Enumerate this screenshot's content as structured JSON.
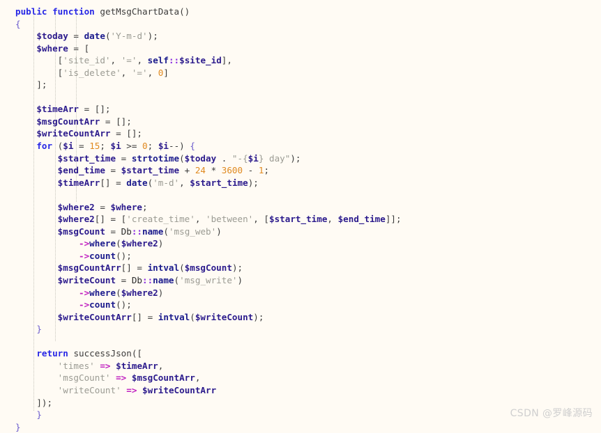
{
  "editor": {
    "language": "PHP",
    "background_color": "#fffbf4",
    "colors": {
      "keyword": "#2727e6",
      "function": "#1a1a8c",
      "variable": "#2b1a8c",
      "string": "#9b9b93",
      "number": "#e08a20",
      "arrow_operator": "#c020c0",
      "double_colon": "#8a2be2",
      "brace": "#6a5acd",
      "plain_text": "#3c3c3c",
      "indent_guide": "#c8c6bd"
    },
    "indent_guide_columns": [
      1,
      2,
      3
    ],
    "code_lines": [
      [
        {
          "t": "public",
          "c": "tok-kw"
        },
        {
          "t": " ",
          "c": "tok-op"
        },
        {
          "t": "function",
          "c": "tok-kw"
        },
        {
          "t": " ",
          "c": "tok-op"
        },
        {
          "t": "getMsgChartData",
          "c": "tok-fname"
        },
        {
          "t": "()",
          "c": "tok-brk"
        }
      ],
      [
        {
          "t": "{",
          "c": "tok-brace"
        }
      ],
      [
        {
          "t": "    ",
          "c": "tok-op"
        },
        {
          "t": "$today",
          "c": "tok-var"
        },
        {
          "t": " = ",
          "c": "tok-op"
        },
        {
          "t": "date",
          "c": "tok-fn"
        },
        {
          "t": "(",
          "c": "tok-brk"
        },
        {
          "t": "'Y-m-d'",
          "c": "tok-str"
        },
        {
          "t": ");",
          "c": "tok-brk"
        }
      ],
      [
        {
          "t": "    ",
          "c": "tok-op"
        },
        {
          "t": "$where",
          "c": "tok-var"
        },
        {
          "t": " = ",
          "c": "tok-op"
        },
        {
          "t": "[",
          "c": "tok-brk"
        }
      ],
      [
        {
          "t": "        ",
          "c": "tok-op"
        },
        {
          "t": "[",
          "c": "tok-brk"
        },
        {
          "t": "'site_id'",
          "c": "tok-str"
        },
        {
          "t": ", ",
          "c": "tok-op"
        },
        {
          "t": "'='",
          "c": "tok-str"
        },
        {
          "t": ", ",
          "c": "tok-op"
        },
        {
          "t": "self",
          "c": "tok-fn"
        },
        {
          "t": "::",
          "c": "tok-dcolon"
        },
        {
          "t": "$site_id",
          "c": "tok-var"
        },
        {
          "t": "],",
          "c": "tok-brk"
        }
      ],
      [
        {
          "t": "        ",
          "c": "tok-op"
        },
        {
          "t": "[",
          "c": "tok-brk"
        },
        {
          "t": "'is_delete'",
          "c": "tok-str"
        },
        {
          "t": ", ",
          "c": "tok-op"
        },
        {
          "t": "'='",
          "c": "tok-str"
        },
        {
          "t": ", ",
          "c": "tok-op"
        },
        {
          "t": "0",
          "c": "tok-num"
        },
        {
          "t": "]",
          "c": "tok-brk"
        }
      ],
      [
        {
          "t": "    ",
          "c": "tok-op"
        },
        {
          "t": "];",
          "c": "tok-brk"
        }
      ],
      [],
      [
        {
          "t": "    ",
          "c": "tok-op"
        },
        {
          "t": "$timeArr",
          "c": "tok-var"
        },
        {
          "t": " = ",
          "c": "tok-op"
        },
        {
          "t": "[];",
          "c": "tok-brk"
        }
      ],
      [
        {
          "t": "    ",
          "c": "tok-op"
        },
        {
          "t": "$msgCountArr",
          "c": "tok-var"
        },
        {
          "t": " = ",
          "c": "tok-op"
        },
        {
          "t": "[];",
          "c": "tok-brk"
        }
      ],
      [
        {
          "t": "    ",
          "c": "tok-op"
        },
        {
          "t": "$writeCountArr",
          "c": "tok-var"
        },
        {
          "t": " = ",
          "c": "tok-op"
        },
        {
          "t": "[];",
          "c": "tok-brk"
        }
      ],
      [
        {
          "t": "    ",
          "c": "tok-op"
        },
        {
          "t": "for",
          "c": "tok-kw"
        },
        {
          "t": " (",
          "c": "tok-brk"
        },
        {
          "t": "$i",
          "c": "tok-var"
        },
        {
          "t": " = ",
          "c": "tok-op"
        },
        {
          "t": "15",
          "c": "tok-num"
        },
        {
          "t": "; ",
          "c": "tok-op"
        },
        {
          "t": "$i",
          "c": "tok-var"
        },
        {
          "t": " >= ",
          "c": "tok-op"
        },
        {
          "t": "0",
          "c": "tok-num"
        },
        {
          "t": "; ",
          "c": "tok-op"
        },
        {
          "t": "$i",
          "c": "tok-var"
        },
        {
          "t": "--) ",
          "c": "tok-op"
        },
        {
          "t": "{",
          "c": "tok-brace"
        }
      ],
      [
        {
          "t": "        ",
          "c": "tok-op"
        },
        {
          "t": "$start_time",
          "c": "tok-var"
        },
        {
          "t": " = ",
          "c": "tok-op"
        },
        {
          "t": "strtotime",
          "c": "tok-fn"
        },
        {
          "t": "(",
          "c": "tok-brk"
        },
        {
          "t": "$today",
          "c": "tok-var"
        },
        {
          "t": " . ",
          "c": "tok-op"
        },
        {
          "t": "\"-{",
          "c": "tok-str"
        },
        {
          "t": "$i",
          "c": "tok-var"
        },
        {
          "t": "} day\"",
          "c": "tok-str"
        },
        {
          "t": ");",
          "c": "tok-brk"
        }
      ],
      [
        {
          "t": "        ",
          "c": "tok-op"
        },
        {
          "t": "$end_time",
          "c": "tok-var"
        },
        {
          "t": " = ",
          "c": "tok-op"
        },
        {
          "t": "$start_time",
          "c": "tok-var"
        },
        {
          "t": " + ",
          "c": "tok-op"
        },
        {
          "t": "24",
          "c": "tok-num"
        },
        {
          "t": " * ",
          "c": "tok-op"
        },
        {
          "t": "3600",
          "c": "tok-num"
        },
        {
          "t": " - ",
          "c": "tok-op"
        },
        {
          "t": "1",
          "c": "tok-num"
        },
        {
          "t": ";",
          "c": "tok-op"
        }
      ],
      [
        {
          "t": "        ",
          "c": "tok-op"
        },
        {
          "t": "$timeArr",
          "c": "tok-var"
        },
        {
          "t": "[]",
          "c": "tok-brk"
        },
        {
          "t": " = ",
          "c": "tok-op"
        },
        {
          "t": "date",
          "c": "tok-fn"
        },
        {
          "t": "(",
          "c": "tok-brk"
        },
        {
          "t": "'m-d'",
          "c": "tok-str"
        },
        {
          "t": ", ",
          "c": "tok-op"
        },
        {
          "t": "$start_time",
          "c": "tok-var"
        },
        {
          "t": ");",
          "c": "tok-brk"
        }
      ],
      [],
      [
        {
          "t": "        ",
          "c": "tok-op"
        },
        {
          "t": "$where2",
          "c": "tok-var"
        },
        {
          "t": " = ",
          "c": "tok-op"
        },
        {
          "t": "$where",
          "c": "tok-var"
        },
        {
          "t": ";",
          "c": "tok-op"
        }
      ],
      [
        {
          "t": "        ",
          "c": "tok-op"
        },
        {
          "t": "$where2",
          "c": "tok-var"
        },
        {
          "t": "[]",
          "c": "tok-brk"
        },
        {
          "t": " = ",
          "c": "tok-op"
        },
        {
          "t": "[",
          "c": "tok-brk"
        },
        {
          "t": "'create_time'",
          "c": "tok-str"
        },
        {
          "t": ", ",
          "c": "tok-op"
        },
        {
          "t": "'between'",
          "c": "tok-str"
        },
        {
          "t": ", [",
          "c": "tok-brk"
        },
        {
          "t": "$start_time",
          "c": "tok-var"
        },
        {
          "t": ", ",
          "c": "tok-op"
        },
        {
          "t": "$end_time",
          "c": "tok-var"
        },
        {
          "t": "]];",
          "c": "tok-brk"
        }
      ],
      [
        {
          "t": "        ",
          "c": "tok-op"
        },
        {
          "t": "$msgCount",
          "c": "tok-var"
        },
        {
          "t": " = ",
          "c": "tok-op"
        },
        {
          "t": "Db",
          "c": "tok-cls"
        },
        {
          "t": "::",
          "c": "tok-dcolon"
        },
        {
          "t": "name",
          "c": "tok-fn"
        },
        {
          "t": "(",
          "c": "tok-brk"
        },
        {
          "t": "'msg_web'",
          "c": "tok-str"
        },
        {
          "t": ")",
          "c": "tok-brk"
        }
      ],
      [
        {
          "t": "            ",
          "c": "tok-op"
        },
        {
          "t": "->",
          "c": "tok-arrow"
        },
        {
          "t": "where",
          "c": "tok-fn"
        },
        {
          "t": "(",
          "c": "tok-brk"
        },
        {
          "t": "$where2",
          "c": "tok-var"
        },
        {
          "t": ")",
          "c": "tok-brk"
        }
      ],
      [
        {
          "t": "            ",
          "c": "tok-op"
        },
        {
          "t": "->",
          "c": "tok-arrow"
        },
        {
          "t": "count",
          "c": "tok-fn"
        },
        {
          "t": "();",
          "c": "tok-brk"
        }
      ],
      [
        {
          "t": "        ",
          "c": "tok-op"
        },
        {
          "t": "$msgCountArr",
          "c": "tok-var"
        },
        {
          "t": "[]",
          "c": "tok-brk"
        },
        {
          "t": " = ",
          "c": "tok-op"
        },
        {
          "t": "intval",
          "c": "tok-fn"
        },
        {
          "t": "(",
          "c": "tok-brk"
        },
        {
          "t": "$msgCount",
          "c": "tok-var"
        },
        {
          "t": ");",
          "c": "tok-brk"
        }
      ],
      [
        {
          "t": "        ",
          "c": "tok-op"
        },
        {
          "t": "$writeCount",
          "c": "tok-var"
        },
        {
          "t": " = ",
          "c": "tok-op"
        },
        {
          "t": "Db",
          "c": "tok-cls"
        },
        {
          "t": "::",
          "c": "tok-dcolon"
        },
        {
          "t": "name",
          "c": "tok-fn"
        },
        {
          "t": "(",
          "c": "tok-brk"
        },
        {
          "t": "'msg_write'",
          "c": "tok-str"
        },
        {
          "t": ")",
          "c": "tok-brk"
        }
      ],
      [
        {
          "t": "            ",
          "c": "tok-op"
        },
        {
          "t": "->",
          "c": "tok-arrow"
        },
        {
          "t": "where",
          "c": "tok-fn"
        },
        {
          "t": "(",
          "c": "tok-brk"
        },
        {
          "t": "$where2",
          "c": "tok-var"
        },
        {
          "t": ")",
          "c": "tok-brk"
        }
      ],
      [
        {
          "t": "            ",
          "c": "tok-op"
        },
        {
          "t": "->",
          "c": "tok-arrow"
        },
        {
          "t": "count",
          "c": "tok-fn"
        },
        {
          "t": "();",
          "c": "tok-brk"
        }
      ],
      [
        {
          "t": "        ",
          "c": "tok-op"
        },
        {
          "t": "$writeCountArr",
          "c": "tok-var"
        },
        {
          "t": "[]",
          "c": "tok-brk"
        },
        {
          "t": " = ",
          "c": "tok-op"
        },
        {
          "t": "intval",
          "c": "tok-fn"
        },
        {
          "t": "(",
          "c": "tok-brk"
        },
        {
          "t": "$writeCount",
          "c": "tok-var"
        },
        {
          "t": ");",
          "c": "tok-brk"
        }
      ],
      [
        {
          "t": "    ",
          "c": "tok-op"
        },
        {
          "t": "}",
          "c": "tok-brace"
        }
      ],
      [],
      [
        {
          "t": "    ",
          "c": "tok-op"
        },
        {
          "t": "return",
          "c": "tok-kw"
        },
        {
          "t": " ",
          "c": "tok-op"
        },
        {
          "t": "successJson",
          "c": "tok-fname"
        },
        {
          "t": "([",
          "c": "tok-brk"
        }
      ],
      [
        {
          "t": "        ",
          "c": "tok-op"
        },
        {
          "t": "'times'",
          "c": "tok-str"
        },
        {
          "t": " ",
          "c": "tok-op"
        },
        {
          "t": "=>",
          "c": "tok-arrow"
        },
        {
          "t": " ",
          "c": "tok-op"
        },
        {
          "t": "$timeArr",
          "c": "tok-var"
        },
        {
          "t": ",",
          "c": "tok-op"
        }
      ],
      [
        {
          "t": "        ",
          "c": "tok-op"
        },
        {
          "t": "'msgCount'",
          "c": "tok-str"
        },
        {
          "t": " ",
          "c": "tok-op"
        },
        {
          "t": "=>",
          "c": "tok-arrow"
        },
        {
          "t": " ",
          "c": "tok-op"
        },
        {
          "t": "$msgCountArr",
          "c": "tok-var"
        },
        {
          "t": ",",
          "c": "tok-op"
        }
      ],
      [
        {
          "t": "        ",
          "c": "tok-op"
        },
        {
          "t": "'writeCount'",
          "c": "tok-str"
        },
        {
          "t": " ",
          "c": "tok-op"
        },
        {
          "t": "=>",
          "c": "tok-arrow"
        },
        {
          "t": " ",
          "c": "tok-op"
        },
        {
          "t": "$writeCountArr",
          "c": "tok-var"
        }
      ],
      [
        {
          "t": "    ",
          "c": "tok-op"
        },
        {
          "t": "]);",
          "c": "tok-brk"
        }
      ],
      [
        {
          "t": "    ",
          "c": "tok-op"
        },
        {
          "t": "}",
          "c": "tok-brace"
        }
      ],
      [
        {
          "t": "}",
          "c": "tok-brace"
        }
      ]
    ]
  },
  "watermark": {
    "text": "CSDN @罗峰源码"
  }
}
